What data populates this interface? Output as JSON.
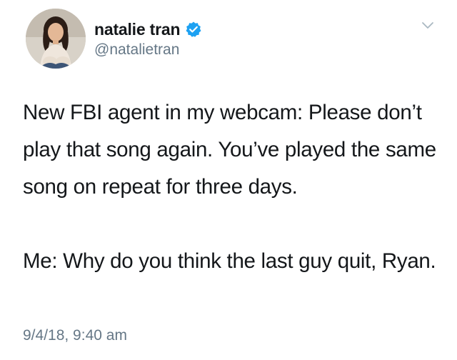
{
  "tweet": {
    "display_name": "natalie tran",
    "handle": "@natalietran",
    "verified": true,
    "paragraphs": [
      "New FBI agent in my webcam: Please don’t play that song again. You’ve played the same song on repeat for three days.",
      "Me: Why do you think the last guy quit, Ryan."
    ],
    "timestamp": "9/4/18, 9:40 am"
  },
  "icons": {
    "verified": "verified-badge-icon",
    "menu": "chevron-down-icon"
  },
  "colors": {
    "verified_blue": "#1da1f2",
    "secondary_text": "#657786",
    "primary_text": "#14171a",
    "chevron": "#aab8c2"
  }
}
